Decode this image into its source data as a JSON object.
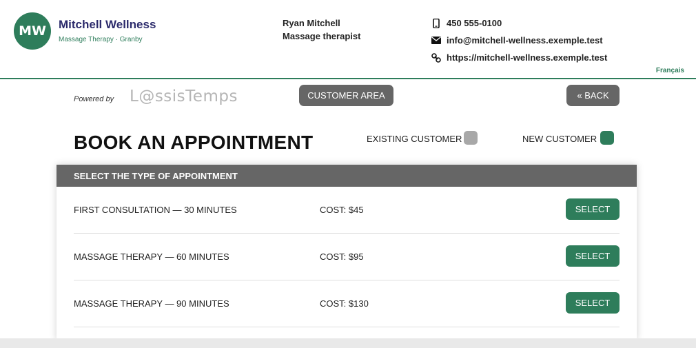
{
  "header": {
    "logo_initials": "MW",
    "brand_name": "Mitchell Wellness",
    "brand_sub": "Massage Therapy · Granby",
    "pro_name": "Ryan Mitchell",
    "pro_role": "Massage therapist",
    "phone": "450 555-0100",
    "email": "info@mitchell-wellness.exemple.test",
    "website": "https://mitchell-wellness.exemple.test",
    "language_link": "Français",
    "icons": [
      "phone-icon",
      "envelope-icon",
      "link-icon"
    ],
    "accent_color": "#2e7d5b",
    "brand_color": "#2b2a6b"
  },
  "toolbar": {
    "powered_by": "Powered by",
    "partner_logo": "L@ssisTemps",
    "customer_area": "CUSTOMER AREA",
    "back": "« BACK"
  },
  "booking": {
    "title": "BOOK AN APPOINTMENT",
    "existing_customer": "EXISTING CUSTOMER",
    "new_customer": "NEW CUSTOMER",
    "existing_color": "#a8a8a8",
    "new_color": "#2e7d5b"
  },
  "appointments": {
    "header": "SELECT THE TYPE OF APPOINTMENT",
    "items": [
      {
        "name": "FIRST CONSULTATION — 30 MINUTES",
        "cost": "COST: $45",
        "action": "SELECT"
      },
      {
        "name": "MASSAGE THERAPY — 60 MINUTES",
        "cost": "COST: $95",
        "action": "SELECT"
      },
      {
        "name": "MASSAGE THERAPY — 90 MINUTES",
        "cost": "COST: $130",
        "action": "SELECT"
      }
    ]
  }
}
